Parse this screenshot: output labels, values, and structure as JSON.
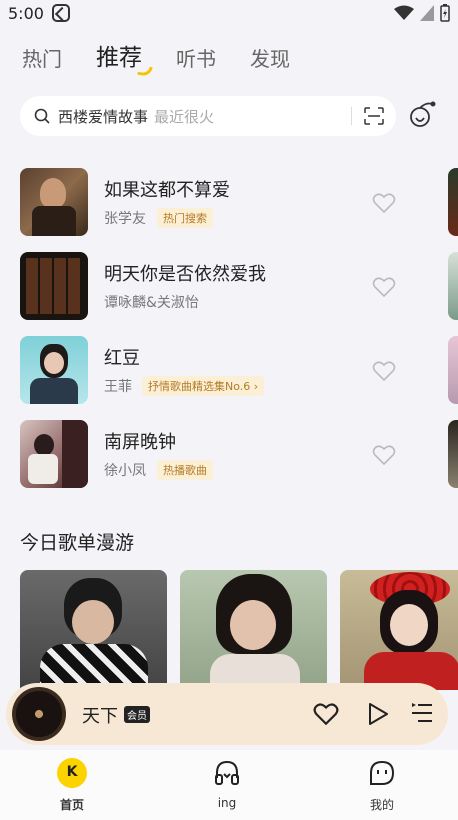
{
  "status_bar": {
    "time": "5:00"
  },
  "top_tabs": [
    {
      "label": "热门",
      "active": false
    },
    {
      "label": "推荐",
      "active": true
    },
    {
      "label": "听书",
      "active": false
    },
    {
      "label": "发现",
      "active": false
    }
  ],
  "search": {
    "query": "西楼爱情故事",
    "hint": "最近很火"
  },
  "songs": [
    {
      "title": "如果这都不算爱",
      "artist": "张学友",
      "tag": "热门搜索"
    },
    {
      "title": "明天你是否依然爱我",
      "artist": "谭咏麟&关淑怡",
      "tag": ""
    },
    {
      "title": "红豆",
      "artist": "王菲",
      "tag": "抒情歌曲精选集No.6 ›"
    },
    {
      "title": "南屏晚钟",
      "artist": "徐小凤",
      "tag": "热播歌曲"
    }
  ],
  "section": {
    "title": "今日歌单漫游"
  },
  "mini_player": {
    "title": "天下",
    "badge": "会员"
  },
  "bottom_nav": [
    {
      "label": "首页"
    },
    {
      "label": "ing"
    },
    {
      "label": "我的"
    }
  ],
  "colors": {
    "accent": "#fbd300",
    "tag_bg": "#fbefd6",
    "tag_text": "#b57b24",
    "player_bg": "#f6e8d4"
  }
}
